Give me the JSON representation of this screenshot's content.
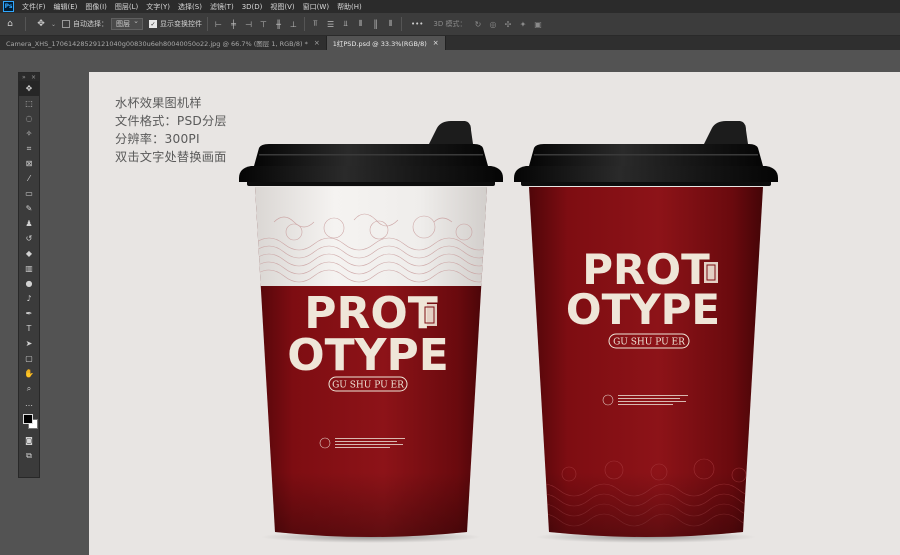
{
  "menu": {
    "logo": "Ps",
    "items": [
      "文件(F)",
      "编辑(E)",
      "图像(I)",
      "图层(L)",
      "文字(Y)",
      "选择(S)",
      "滤镜(T)",
      "3D(D)",
      "视图(V)",
      "窗口(W)",
      "帮助(H)"
    ]
  },
  "options": {
    "auto_select_label": "自动选择：",
    "layer_dropdown": "图层",
    "show_transform_label": "显示变换控件",
    "more": "•••",
    "mode_3d": "3D 模式："
  },
  "tabs": [
    {
      "label": "Camera_XHS_17061428529121040g00830u6eh80040050o22.jpg @ 66.7% (图层 1, RGB/8) *",
      "close": "×"
    },
    {
      "label": "1红PSD.psd @ 33.3%(RGB/8)",
      "close": "×"
    }
  ],
  "toolbar": {
    "collapse": "»",
    "close": "×"
  },
  "canvas": {
    "caption": [
      "水杯效果图机样",
      "文件格式：PSD分层",
      "分辨率：300PI",
      "双击文字处替换画面"
    ]
  },
  "cup_left": {
    "line1": "PROT",
    "line2": "OTYPE",
    "badge": "GU SHU PU ER"
  },
  "cup_right": {
    "line1": "PROT",
    "line2": "OTYPE",
    "badge": "GU SHU PU ER"
  },
  "colors": {
    "cup_red": "#7e0d12",
    "cup_red_dark": "#4a0508",
    "lid": "#161616",
    "canvas_bg": "#e8e5e3",
    "text_cream": "#efe6d8"
  }
}
